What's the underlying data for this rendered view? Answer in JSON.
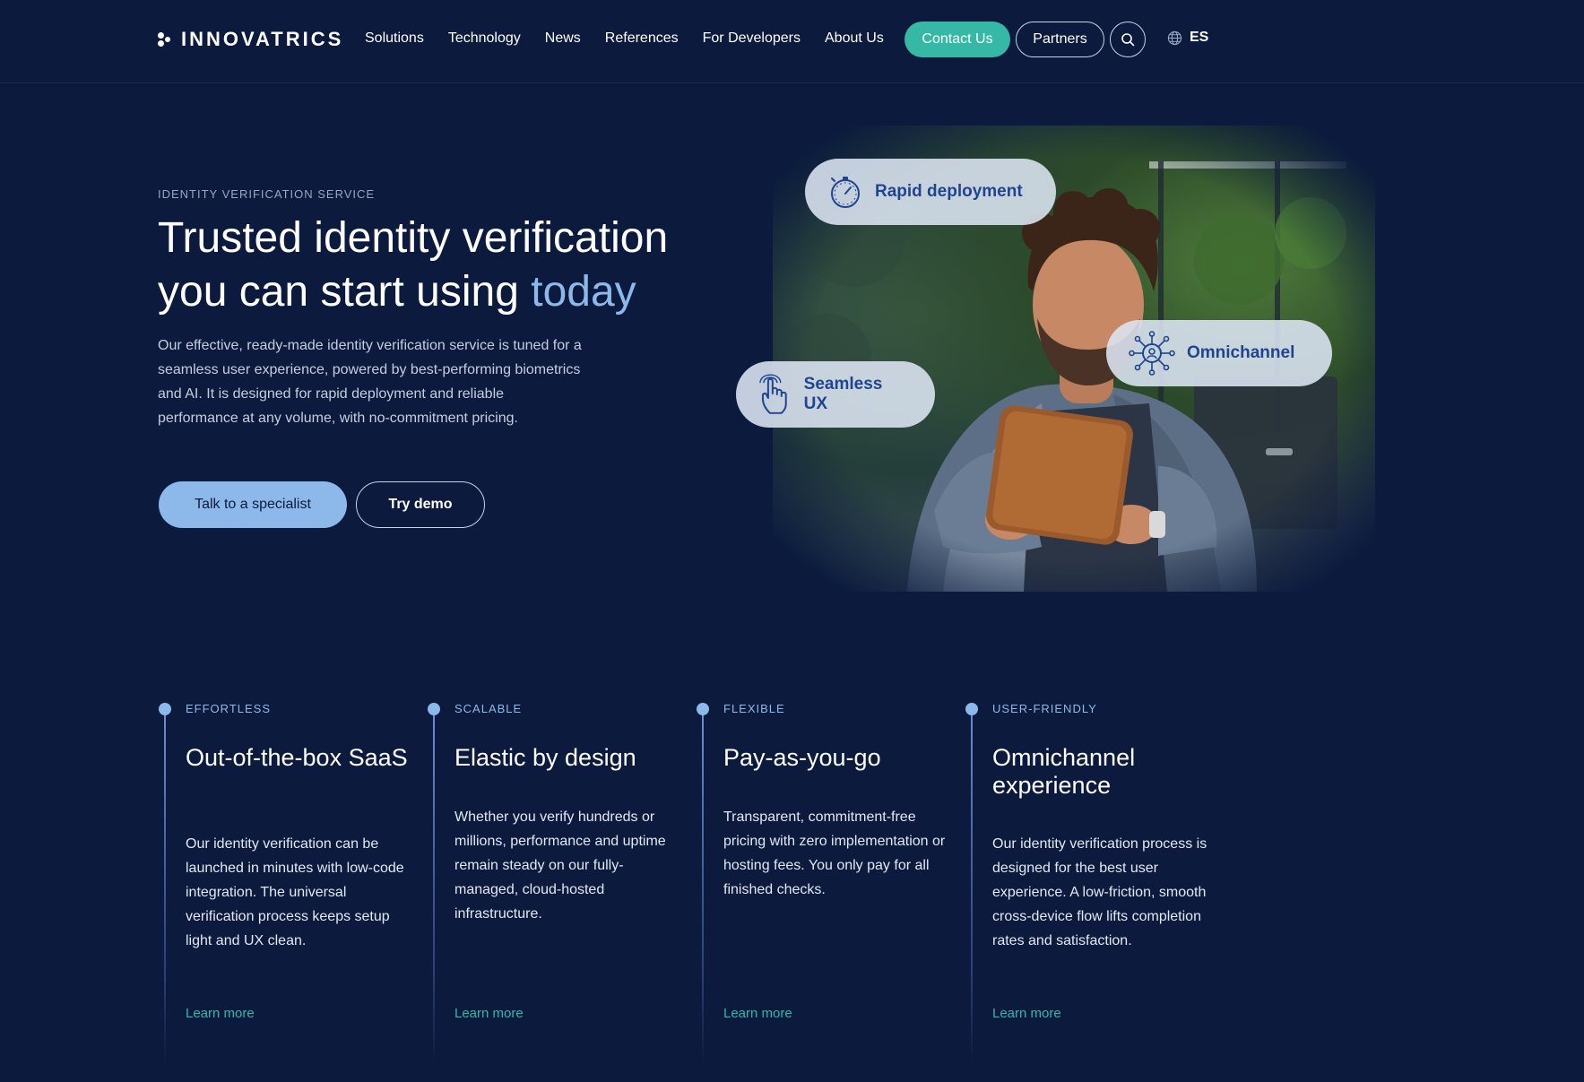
{
  "header": {
    "logo_text": "INNOVATRICS",
    "nav": [
      "Solutions",
      "Technology",
      "News",
      "References",
      "For Developers",
      "About Us"
    ],
    "contact_label": "Contact Us",
    "partners_label": "Partners",
    "language": "ES"
  },
  "hero": {
    "eyebrow": "IDENTITY VERIFICATION SERVICE",
    "title_line1": "Trusted identity verification",
    "title_line2_prefix": "you can start using ",
    "title_highlight": "today",
    "description": "Our effective, ready-made identity verification service is tuned for a seamless user experience, powered by best-performing biometrics and AI. It is designed for rapid deployment and reliable performance at any volume, with no-commitment pricing.",
    "cta_primary": "Talk to a specialist",
    "cta_secondary": "Try demo",
    "pills": {
      "rapid": "Rapid deployment",
      "omni": "Omnichannel",
      "ux": "Seamless UX"
    }
  },
  "features": [
    {
      "label": "EFFORTLESS",
      "title": "Out-of-the-box SaaS",
      "description": "Our identity verification can be launched in minutes with low-code integration. The universal verification process keeps setup light and UX clean.",
      "link": "Learn more"
    },
    {
      "label": "SCALABLE",
      "title": "Elastic by design",
      "description": "Whether you verify hundreds or millions, performance and uptime remain steady on our fully-managed, cloud-hosted infrastructure.",
      "link": "Learn more"
    },
    {
      "label": "FLEXIBLE",
      "title": "Pay-as-you-go",
      "description": "Transparent, commitment-free pricing with zero implementation or hosting fees. You only pay for all finished checks.",
      "link": "Learn more"
    },
    {
      "label": "USER-FRIENDLY",
      "title": "Omnichannel experience",
      "description": "Our identity verification process is designed for the best user experience. A low-friction, smooth cross-device flow lifts completion rates and satisfaction.",
      "link": "Learn more"
    }
  ],
  "colors": {
    "background": "#0b1a3d",
    "accent_teal": "#35b8a6",
    "accent_blue": "#8db8ea",
    "pill_text": "#1f4590"
  }
}
